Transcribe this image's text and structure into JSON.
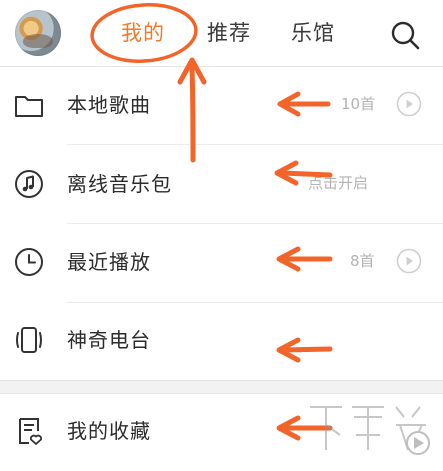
{
  "header": {
    "tabs": [
      {
        "label": "我的",
        "active": true
      },
      {
        "label": "推荐",
        "active": false
      },
      {
        "label": "乐馆",
        "active": false
      }
    ],
    "search_icon": "search-icon",
    "avatar_icon": "user-avatar"
  },
  "list": {
    "items": [
      {
        "label": "本地歌曲",
        "meta": "10首",
        "icon": "folder-icon",
        "has_play": true
      },
      {
        "label": "离线音乐包",
        "meta": "点击开启",
        "icon": "music-note-icon",
        "has_play": false
      },
      {
        "label": "最近播放",
        "meta": "8首",
        "icon": "clock-icon",
        "has_play": true
      },
      {
        "label": "神奇电台",
        "meta": "",
        "icon": "phone-radio-icon",
        "has_play": false
      },
      {
        "label": "我的收藏",
        "meta": "",
        "icon": "favorites-list-icon",
        "has_play": false
      }
    ]
  },
  "colors": {
    "accent": "#f07a2a",
    "annotation": "#f2642a",
    "text": "#2b2b2b",
    "meta": "#b3b3b3"
  }
}
